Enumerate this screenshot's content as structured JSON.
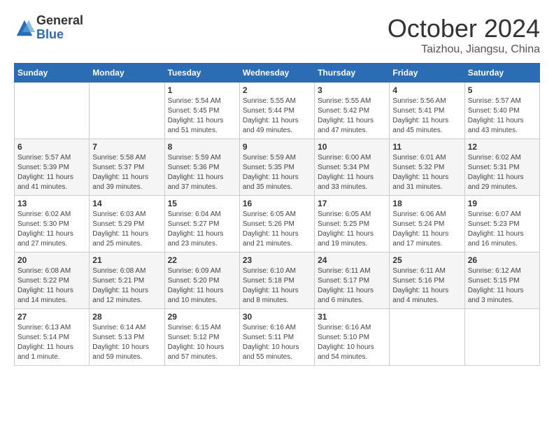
{
  "logo": {
    "general": "General",
    "blue": "Blue"
  },
  "title": "October 2024",
  "subtitle": "Taizhou, Jiangsu, China",
  "days_header": [
    "Sunday",
    "Monday",
    "Tuesday",
    "Wednesday",
    "Thursday",
    "Friday",
    "Saturday"
  ],
  "weeks": [
    [
      {
        "day": "",
        "info": ""
      },
      {
        "day": "",
        "info": ""
      },
      {
        "day": "1",
        "info": "Sunrise: 5:54 AM\nSunset: 5:45 PM\nDaylight: 11 hours and 51 minutes."
      },
      {
        "day": "2",
        "info": "Sunrise: 5:55 AM\nSunset: 5:44 PM\nDaylight: 11 hours and 49 minutes."
      },
      {
        "day": "3",
        "info": "Sunrise: 5:55 AM\nSunset: 5:42 PM\nDaylight: 11 hours and 47 minutes."
      },
      {
        "day": "4",
        "info": "Sunrise: 5:56 AM\nSunset: 5:41 PM\nDaylight: 11 hours and 45 minutes."
      },
      {
        "day": "5",
        "info": "Sunrise: 5:57 AM\nSunset: 5:40 PM\nDaylight: 11 hours and 43 minutes."
      }
    ],
    [
      {
        "day": "6",
        "info": "Sunrise: 5:57 AM\nSunset: 5:39 PM\nDaylight: 11 hours and 41 minutes."
      },
      {
        "day": "7",
        "info": "Sunrise: 5:58 AM\nSunset: 5:37 PM\nDaylight: 11 hours and 39 minutes."
      },
      {
        "day": "8",
        "info": "Sunrise: 5:59 AM\nSunset: 5:36 PM\nDaylight: 11 hours and 37 minutes."
      },
      {
        "day": "9",
        "info": "Sunrise: 5:59 AM\nSunset: 5:35 PM\nDaylight: 11 hours and 35 minutes."
      },
      {
        "day": "10",
        "info": "Sunrise: 6:00 AM\nSunset: 5:34 PM\nDaylight: 11 hours and 33 minutes."
      },
      {
        "day": "11",
        "info": "Sunrise: 6:01 AM\nSunset: 5:32 PM\nDaylight: 11 hours and 31 minutes."
      },
      {
        "day": "12",
        "info": "Sunrise: 6:02 AM\nSunset: 5:31 PM\nDaylight: 11 hours and 29 minutes."
      }
    ],
    [
      {
        "day": "13",
        "info": "Sunrise: 6:02 AM\nSunset: 5:30 PM\nDaylight: 11 hours and 27 minutes."
      },
      {
        "day": "14",
        "info": "Sunrise: 6:03 AM\nSunset: 5:29 PM\nDaylight: 11 hours and 25 minutes."
      },
      {
        "day": "15",
        "info": "Sunrise: 6:04 AM\nSunset: 5:27 PM\nDaylight: 11 hours and 23 minutes."
      },
      {
        "day": "16",
        "info": "Sunrise: 6:05 AM\nSunset: 5:26 PM\nDaylight: 11 hours and 21 minutes."
      },
      {
        "day": "17",
        "info": "Sunrise: 6:05 AM\nSunset: 5:25 PM\nDaylight: 11 hours and 19 minutes."
      },
      {
        "day": "18",
        "info": "Sunrise: 6:06 AM\nSunset: 5:24 PM\nDaylight: 11 hours and 17 minutes."
      },
      {
        "day": "19",
        "info": "Sunrise: 6:07 AM\nSunset: 5:23 PM\nDaylight: 11 hours and 16 minutes."
      }
    ],
    [
      {
        "day": "20",
        "info": "Sunrise: 6:08 AM\nSunset: 5:22 PM\nDaylight: 11 hours and 14 minutes."
      },
      {
        "day": "21",
        "info": "Sunrise: 6:08 AM\nSunset: 5:21 PM\nDaylight: 11 hours and 12 minutes."
      },
      {
        "day": "22",
        "info": "Sunrise: 6:09 AM\nSunset: 5:20 PM\nDaylight: 11 hours and 10 minutes."
      },
      {
        "day": "23",
        "info": "Sunrise: 6:10 AM\nSunset: 5:18 PM\nDaylight: 11 hours and 8 minutes."
      },
      {
        "day": "24",
        "info": "Sunrise: 6:11 AM\nSunset: 5:17 PM\nDaylight: 11 hours and 6 minutes."
      },
      {
        "day": "25",
        "info": "Sunrise: 6:11 AM\nSunset: 5:16 PM\nDaylight: 11 hours and 4 minutes."
      },
      {
        "day": "26",
        "info": "Sunrise: 6:12 AM\nSunset: 5:15 PM\nDaylight: 11 hours and 3 minutes."
      }
    ],
    [
      {
        "day": "27",
        "info": "Sunrise: 6:13 AM\nSunset: 5:14 PM\nDaylight: 11 hours and 1 minute."
      },
      {
        "day": "28",
        "info": "Sunrise: 6:14 AM\nSunset: 5:13 PM\nDaylight: 10 hours and 59 minutes."
      },
      {
        "day": "29",
        "info": "Sunrise: 6:15 AM\nSunset: 5:12 PM\nDaylight: 10 hours and 57 minutes."
      },
      {
        "day": "30",
        "info": "Sunrise: 6:16 AM\nSunset: 5:11 PM\nDaylight: 10 hours and 55 minutes."
      },
      {
        "day": "31",
        "info": "Sunrise: 6:16 AM\nSunset: 5:10 PM\nDaylight: 10 hours and 54 minutes."
      },
      {
        "day": "",
        "info": ""
      },
      {
        "day": "",
        "info": ""
      }
    ]
  ]
}
